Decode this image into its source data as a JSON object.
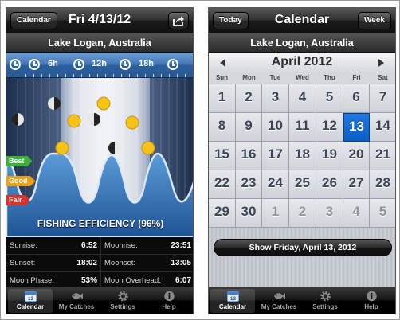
{
  "left": {
    "nav": {
      "left_button": "Calendar",
      "title": "Fri 4/13/12",
      "share_icon": "share-icon"
    },
    "location": "Lake Logan, Australia",
    "hours": [
      "6h",
      "12h",
      "18h"
    ],
    "ratings": [
      {
        "label": "Best",
        "color": "#3fae3a"
      },
      {
        "label": "Good",
        "color": "#e6a21a"
      },
      {
        "label": "Fair",
        "color": "#d8332a"
      }
    ],
    "efficiency_label": "FISHING EFFICIENCY (96%)",
    "efficiency": 0.96,
    "info": {
      "sunrise": {
        "label": "Sunrise:",
        "value": "6:52"
      },
      "sunset": {
        "label": "Sunset:",
        "value": "18:02"
      },
      "moon_phase": {
        "label": "Moon Phase:",
        "value": "53%"
      },
      "moonrise": {
        "label": "Moonrise:",
        "value": "23:51"
      },
      "moonset": {
        "label": "Moonset:",
        "value": "13:05"
      },
      "moon_overhead": {
        "label": "Moon Overhead:",
        "value": "6:07"
      }
    }
  },
  "right": {
    "nav": {
      "left_button": "Today",
      "title": "Calendar",
      "right_button": "Week"
    },
    "location": "Lake Logan, Australia",
    "month": "April 2012",
    "weekdays": [
      "Sun",
      "Mon",
      "Tue",
      "Wed",
      "Thu",
      "Fri",
      "Sat"
    ],
    "weeks": [
      [
        {
          "d": "1"
        },
        {
          "d": "2"
        },
        {
          "d": "3"
        },
        {
          "d": "4"
        },
        {
          "d": "5"
        },
        {
          "d": "6"
        },
        {
          "d": "7"
        }
      ],
      [
        {
          "d": "8"
        },
        {
          "d": "9"
        },
        {
          "d": "10"
        },
        {
          "d": "11"
        },
        {
          "d": "12"
        },
        {
          "d": "13",
          "selected": true
        },
        {
          "d": "14"
        }
      ],
      [
        {
          "d": "15"
        },
        {
          "d": "16"
        },
        {
          "d": "17"
        },
        {
          "d": "18"
        },
        {
          "d": "19"
        },
        {
          "d": "20"
        },
        {
          "d": "21"
        }
      ],
      [
        {
          "d": "22"
        },
        {
          "d": "23"
        },
        {
          "d": "24"
        },
        {
          "d": "25"
        },
        {
          "d": "26"
        },
        {
          "d": "27"
        },
        {
          "d": "28"
        }
      ],
      [
        {
          "d": "29"
        },
        {
          "d": "30"
        },
        {
          "d": "1",
          "other": true
        },
        {
          "d": "2",
          "other": true
        },
        {
          "d": "3",
          "other": true
        },
        {
          "d": "4",
          "other": true
        },
        {
          "d": "5",
          "other": true
        }
      ]
    ],
    "show_button": "Show Friday, April 13, 2012"
  },
  "tabs": [
    {
      "label": "Calendar",
      "icon": "calendar-icon"
    },
    {
      "label": "My Catches",
      "icon": "fish-icon"
    },
    {
      "label": "Settings",
      "icon": "gear-icon"
    },
    {
      "label": "Help",
      "icon": "info-icon"
    }
  ],
  "colors": {
    "accent_blue": "#0a5ec5",
    "chart_fill": "#3d7fc4"
  }
}
